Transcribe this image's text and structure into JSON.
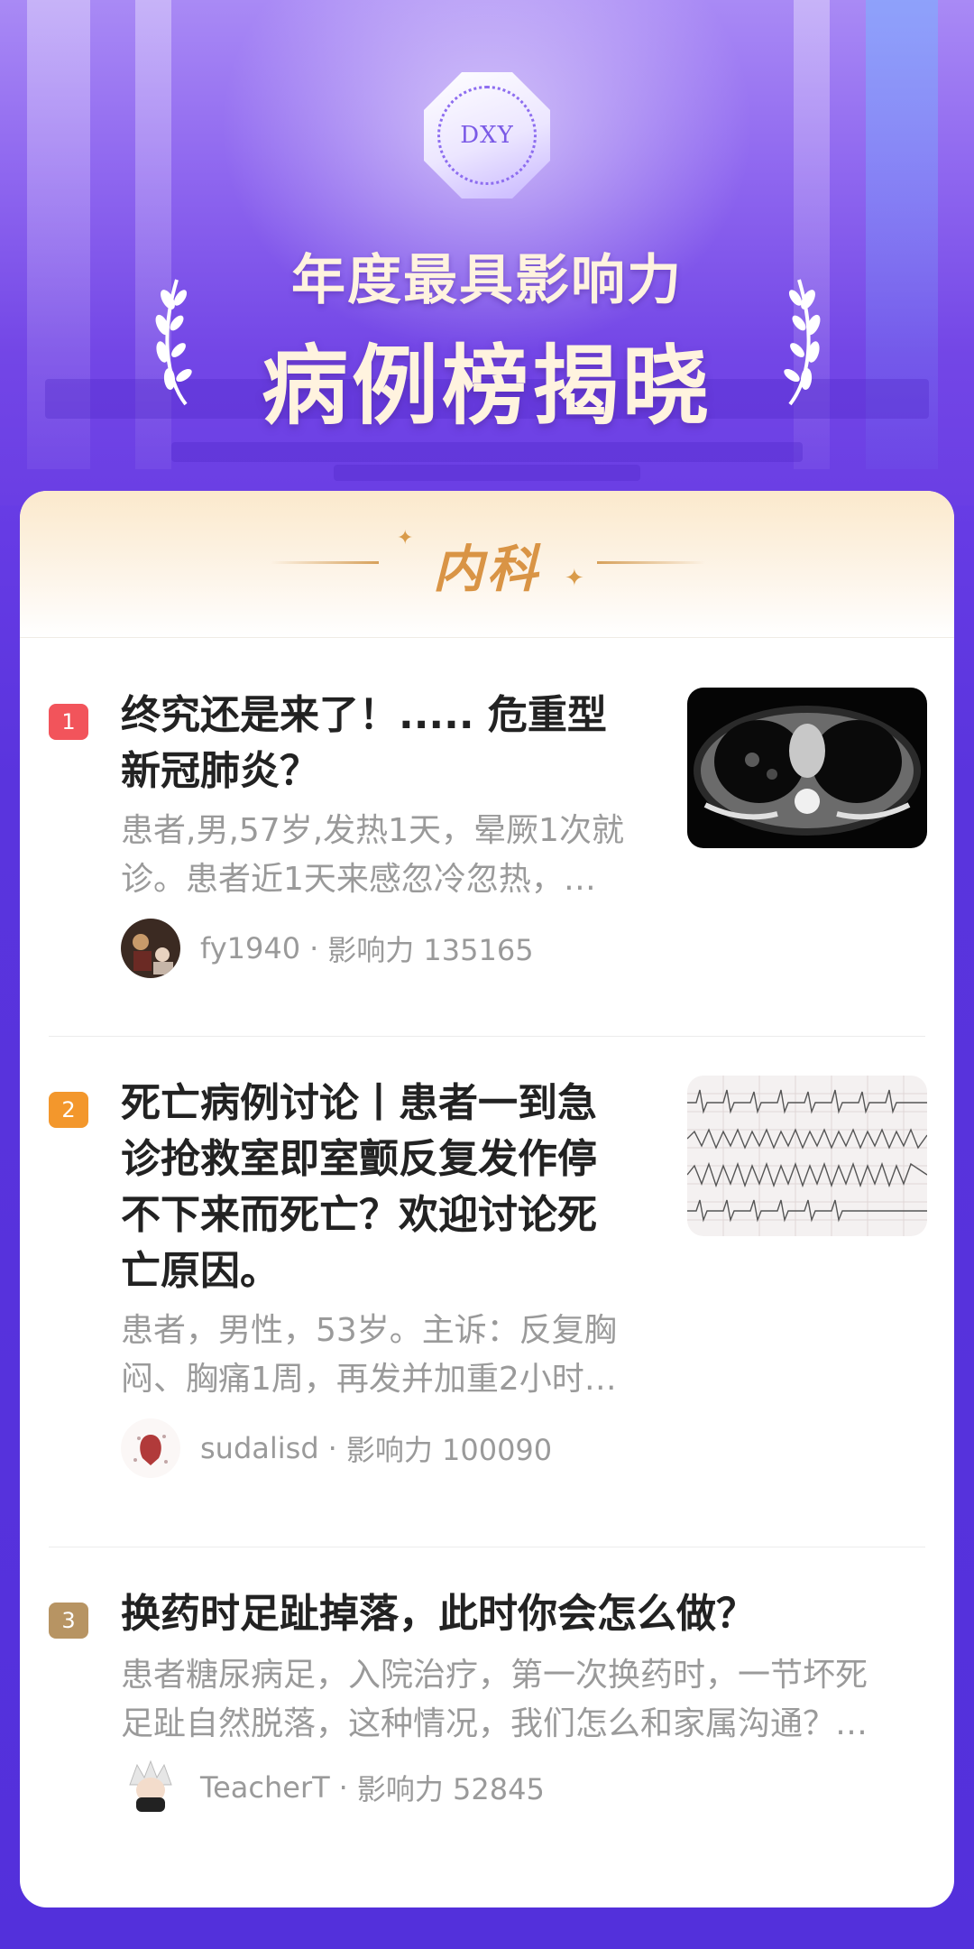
{
  "hero": {
    "badge_text": "DXY",
    "subtitle": "年度最具影响力",
    "title": "病例榜揭晓"
  },
  "card": {
    "category": "内科"
  },
  "colors": {
    "rank1": "#f2545b",
    "rank2": "#f3972c",
    "rank3": "#b79463",
    "accent_gold": "#d99445"
  },
  "items": [
    {
      "rank": "1",
      "title_lines": [
        "终究还是来了！..... 危重型",
        "新冠肺炎？"
      ],
      "summary_lines": [
        "患者,男,57岁,发热1天，晕厥1次就",
        "诊。患者近1天来感忽冷忽热，…"
      ],
      "author": "fy1940",
      "influence": "影响力 135165",
      "thumb": "ct-scan"
    },
    {
      "rank": "2",
      "title_lines": [
        "死亡病例讨论丨患者一到急",
        "诊抢救室即室颤反复发作停",
        "不下来而死亡？欢迎讨论死",
        "亡原因。"
      ],
      "summary_lines": [
        "患者，男性，53岁。主诉：反复胸",
        "闷、胸痛1周，再发并加重2小时…"
      ],
      "author": "sudalisd",
      "influence": "影响力 100090",
      "thumb": "ecg"
    },
    {
      "rank": "3",
      "title_lines": [
        "换药时足趾掉落，此时你会怎么做？"
      ],
      "summary_lines": [
        "患者糖尿病足，入院治疗，第一次换药时，一节坏死",
        "足趾自然脱落，这种情况，我们怎么和家属沟通？…"
      ],
      "author": "TeacherT",
      "influence": "影响力 52845",
      "thumb": ""
    }
  ]
}
